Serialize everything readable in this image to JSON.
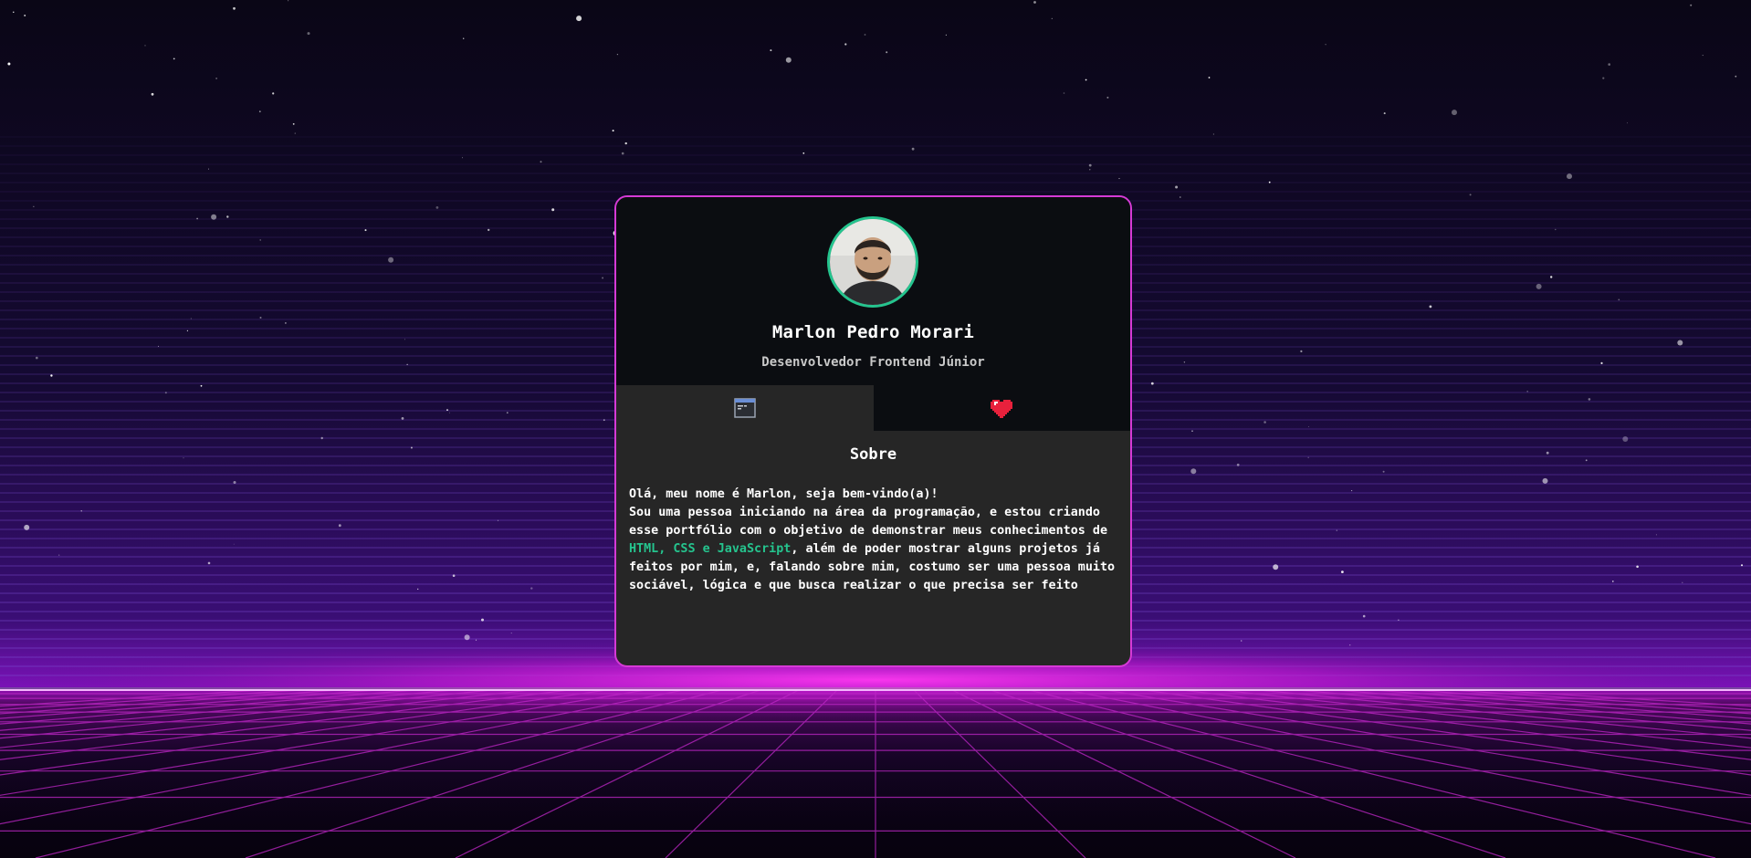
{
  "profile": {
    "name": "Marlon Pedro Morari",
    "role": "Desenvolvedor Frontend Júnior",
    "avatar_alt": "Marlon Pedro Morari"
  },
  "tabs": [
    {
      "label": "Sobre",
      "icon": "window-icon",
      "active": true
    },
    {
      "label": "",
      "icon": "heart-icon",
      "active": false
    }
  ],
  "about": {
    "title": "Sobre",
    "greeting": "Olá, meu nome é Marlon, seja bem-vindo(a)!",
    "body_before": "Sou uma pessoa iniciando na área da programação, e estou criando esse portfólio com o objetivo de demonstrar meus conhecimentos de ",
    "highlight": "HTML, CSS e JavaScript",
    "body_after": ", além de poder mostrar alguns projetos já feitos por mim, e, falando sobre mim, costumo ser uma pessoa muito sociável, lógica e que busca realizar o que precisa ser feito"
  },
  "colors": {
    "accent_green": "#25c48e",
    "border_magenta": "#d63ad6",
    "card_header": "#0b0d11",
    "card_body": "#262626",
    "background": "#0b0618"
  }
}
